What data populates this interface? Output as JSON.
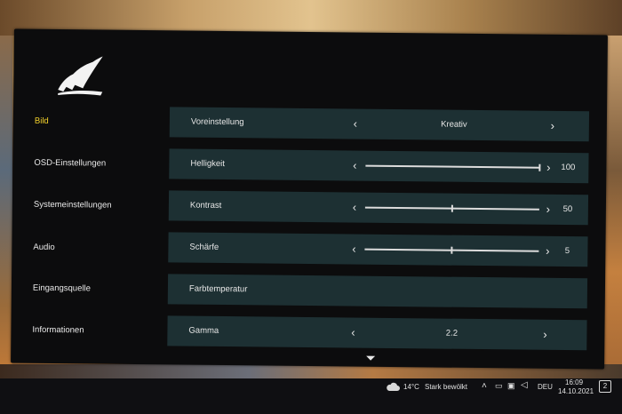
{
  "sidebar": {
    "items": [
      {
        "label": "Bild",
        "active": true
      },
      {
        "label": "OSD-Einstellungen",
        "active": false
      },
      {
        "label": "Systemeinstellungen",
        "active": false
      },
      {
        "label": "Audio",
        "active": false
      },
      {
        "label": "Eingangsquelle",
        "active": false
      },
      {
        "label": "Informationen",
        "active": false
      }
    ]
  },
  "settings": {
    "preset": {
      "label": "Voreinstellung",
      "value": "Kreativ"
    },
    "brightness": {
      "label": "Helligkeit",
      "value": "100",
      "level": 100
    },
    "contrast": {
      "label": "Kontrast",
      "value": "50",
      "level": 50
    },
    "sharpness": {
      "label": "Schärfe",
      "value": "5",
      "level": 50
    },
    "color_temp": {
      "label": "Farbtemperatur"
    },
    "gamma": {
      "label": "Gamma",
      "value": "2.2"
    }
  },
  "icons": {
    "left": "‹",
    "right": "›",
    "logo": "corsair-sails-logo",
    "scroll": "chevron-down-icon"
  },
  "taskbar": {
    "temperature": "14°C",
    "weather": "Stark bewölkt",
    "language": "DEU",
    "time": "16:09",
    "date": "14.10.2021",
    "notifications": "2"
  },
  "colors": {
    "active_item": "#f4d22b",
    "row_bg": "#1d3033",
    "panel_bg": "#0c0c0d"
  }
}
